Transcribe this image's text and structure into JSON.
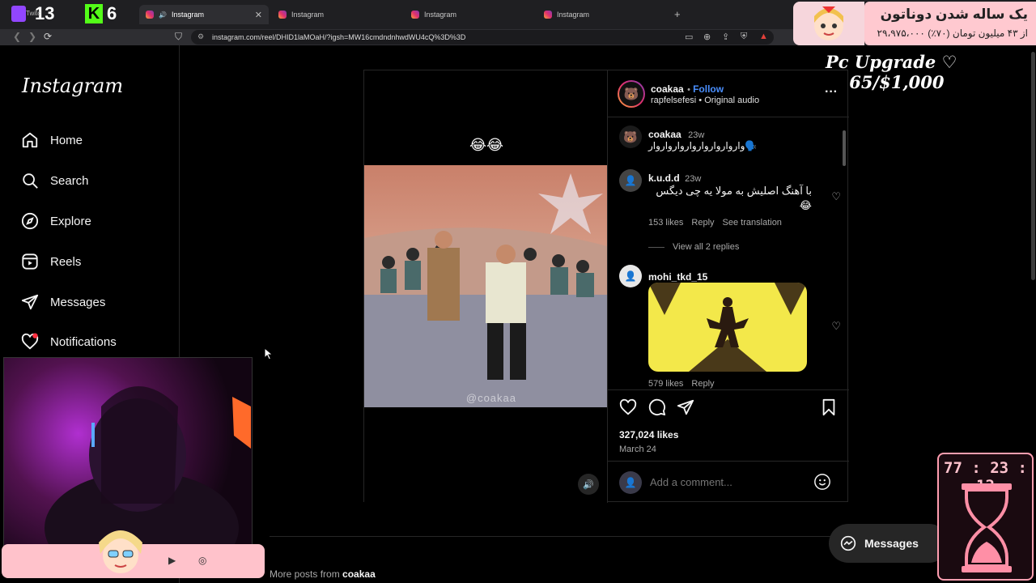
{
  "overlay": {
    "twitch_label": "Twitc",
    "twitch_count": "13",
    "kick_letter": "K",
    "kick_count": "6",
    "donation_title": "یک ساله شدن دوناتون",
    "donation_progress": "۲۹،۹۷۵،۰۰۰ از ۴۳ میلیون تومان (۷۰٪)",
    "pc_goal": "Pc Upgrade ♡ $165/$1,000",
    "timer": "77 : 23 : 12"
  },
  "browser": {
    "tabs": [
      {
        "label": "Instagram",
        "active": true
      },
      {
        "label": "Instagram",
        "active": false
      },
      {
        "label": "Instagram",
        "active": false
      },
      {
        "label": "Instagram",
        "active": false
      }
    ],
    "url": "instagram.com/reel/DHID1laMOaH/?igsh=MW16cmdndnhwdWU4cQ%3D%3D"
  },
  "sidebar": {
    "logo": "Instagram",
    "items": [
      {
        "label": "Home",
        "icon": "home-icon"
      },
      {
        "label": "Search",
        "icon": "search-icon"
      },
      {
        "label": "Explore",
        "icon": "compass-icon"
      },
      {
        "label": "Reels",
        "icon": "reels-icon"
      },
      {
        "label": "Messages",
        "icon": "send-icon"
      },
      {
        "label": "Notifications",
        "icon": "heart-icon"
      }
    ]
  },
  "post": {
    "video_caption": "😂😂",
    "watermark": "@coakaa",
    "author": "coakaa",
    "follow_label": "Follow",
    "audio": "rapfelsefesi • Original audio",
    "likes": "327,024 likes",
    "date": "March 24",
    "comment_placeholder": "Add a comment...",
    "comments": [
      {
        "user": "coakaa",
        "time": "23w",
        "text": "واروارواروارواروارواروار🗣️"
      },
      {
        "user": "k.u.d.d",
        "time": "23w",
        "text": "با آهنگ اصلیش به مولا یه چی دیگس 😂",
        "likes": "153 likes",
        "reply": "Reply",
        "translate": "See translation",
        "view_replies": "View all 2 replies"
      },
      {
        "user": "mohi_tkd_15",
        "likes": "579 likes",
        "reply": "Reply"
      }
    ]
  },
  "footer": {
    "more_prefix": "More posts from",
    "more_user": "coakaa",
    "messages_label": "Messages"
  }
}
